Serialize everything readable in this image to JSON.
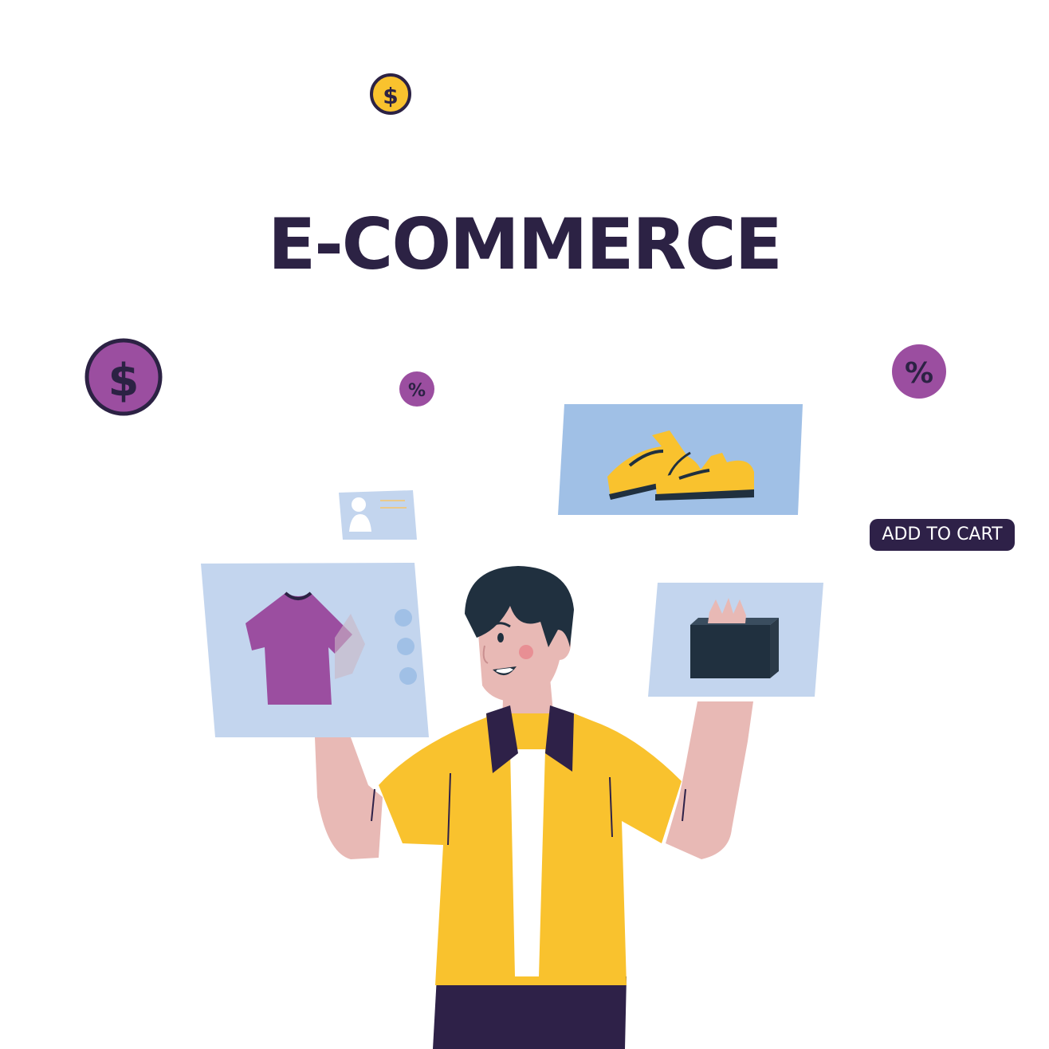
{
  "title": "E-COMMERCE",
  "cart_button": {
    "label": "ADD TO CART"
  },
  "coins": {
    "dollar_symbol": "$",
    "percent_symbol": "%"
  },
  "colors": {
    "ink": "#2c2244",
    "purple": "#9b4ea0",
    "yellow": "#f9c22e",
    "panel": "#c3d5ee",
    "panel_dark": "#a0c0e6",
    "skin": "#e8b9b5",
    "hair": "#20303f"
  }
}
